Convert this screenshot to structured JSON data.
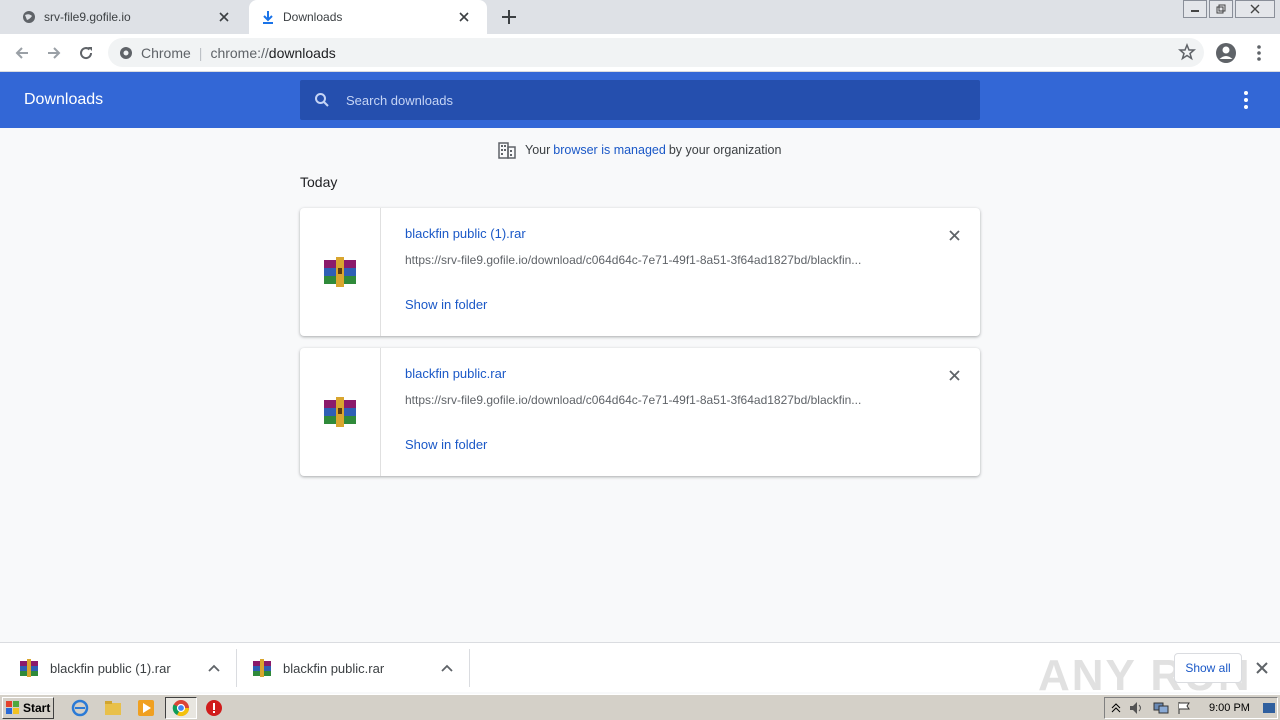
{
  "tabs": [
    {
      "title": "srv-file9.gofile.io",
      "icon": "globe-icon",
      "active": false
    },
    {
      "title": "Downloads",
      "icon": "download-icon",
      "active": true
    }
  ],
  "omnibox": {
    "chip": "Chrome",
    "url_scheme": "chrome://",
    "url_host": "downloads"
  },
  "header": {
    "title": "Downloads",
    "search_placeholder": "Search downloads"
  },
  "managed": {
    "prefix": "Your",
    "link": "browser is managed",
    "suffix": "by your organization"
  },
  "date_label": "Today",
  "downloads": [
    {
      "filename": "blackfin public (1).rar",
      "url": "https://srv-file9.gofile.io/download/c064d64c-7e71-49f1-8a51-3f64ad1827bd/blackfin...",
      "action": "Show in folder"
    },
    {
      "filename": "blackfin public.rar",
      "url": "https://srv-file9.gofile.io/download/c064d64c-7e71-49f1-8a51-3f64ad1827bd/blackfin...",
      "action": "Show in folder"
    }
  ],
  "shelf": {
    "items": [
      "blackfin public (1).rar",
      "blackfin public.rar"
    ],
    "show_all": "Show all",
    "watermark": "ANY RUN"
  },
  "taskbar": {
    "start": "Start",
    "clock": "9:00 PM"
  },
  "colors": {
    "header_blue": "#3367d6",
    "link_blue": "#1a58c7",
    "search_bg": "#254fae"
  }
}
